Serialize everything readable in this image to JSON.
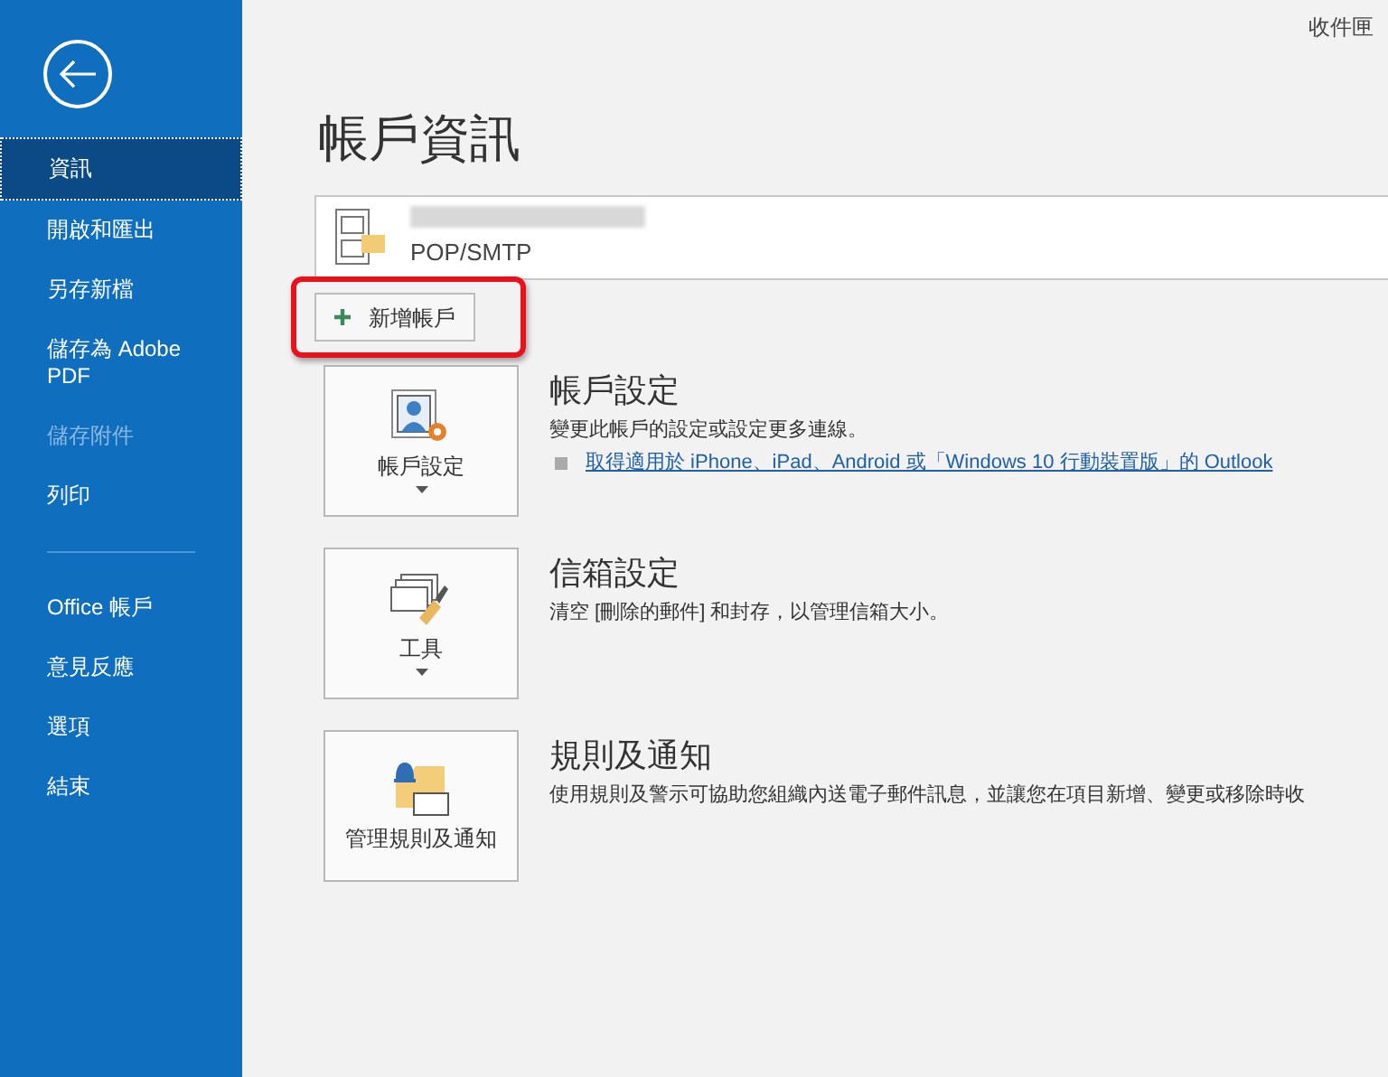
{
  "header": {
    "folder": "收件匣"
  },
  "sidebar": {
    "items": [
      {
        "kind": "item",
        "label": "資訊",
        "selected": true,
        "disabled": false
      },
      {
        "kind": "item",
        "label": "開啟和匯出",
        "selected": false,
        "disabled": false
      },
      {
        "kind": "item",
        "label": "另存新檔",
        "selected": false,
        "disabled": false
      },
      {
        "kind": "item",
        "label": "儲存為 Adobe PDF",
        "selected": false,
        "disabled": false
      },
      {
        "kind": "item",
        "label": "儲存附件",
        "selected": false,
        "disabled": true
      },
      {
        "kind": "item",
        "label": "列印",
        "selected": false,
        "disabled": false
      },
      {
        "kind": "divider"
      },
      {
        "kind": "item",
        "label": "Office 帳戶",
        "selected": false,
        "disabled": false
      },
      {
        "kind": "item",
        "label": "意見反應",
        "selected": false,
        "disabled": false
      },
      {
        "kind": "item",
        "label": "選項",
        "selected": false,
        "disabled": false
      },
      {
        "kind": "item",
        "label": "結束",
        "selected": false,
        "disabled": false
      }
    ]
  },
  "page_title": "帳戶資訊",
  "account": {
    "type": "POP/SMTP"
  },
  "add_account_button": {
    "label": "新增帳戶",
    "highlighted": true
  },
  "sections": [
    {
      "kind": "account",
      "button_label": "帳戶設定",
      "dropdown": true,
      "title": "帳戶設定",
      "description": "變更此帳戶的設定或設定更多連線。",
      "link": "取得適用於 iPhone、iPad、Android 或「Windows 10 行動裝置版」的 Outlook"
    },
    {
      "kind": "tools",
      "button_label": "工具",
      "dropdown": true,
      "title": "信箱設定",
      "description": "清空 [刪除的郵件] 和封存，以管理信箱大小。"
    },
    {
      "kind": "rules",
      "button_label": "管理規則及通知",
      "dropdown": false,
      "title": "規則及通知",
      "description": "使用規則及警示可協助您組織內送電子郵件訊息，並讓您在項目新增、變更或移除時收"
    }
  ]
}
